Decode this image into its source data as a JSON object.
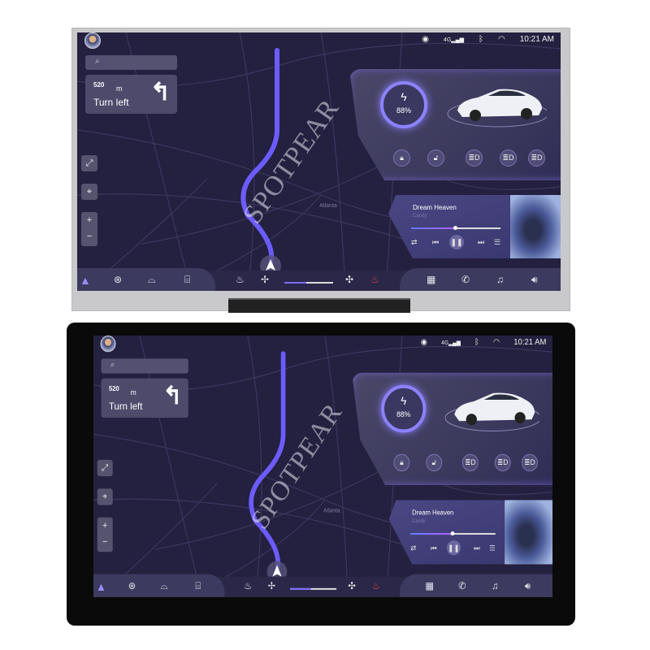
{
  "status": {
    "icons": [
      "eye-icon",
      "signal-4g-icon",
      "bluetooth-icon",
      "wifi-icon"
    ],
    "signal_label": "4G",
    "time": "10:21 AM"
  },
  "navigation": {
    "distance": "520",
    "unit": "m",
    "instruction": "Turn left",
    "map_label": "Atlanta"
  },
  "map_controls": {
    "zoom_in": "+",
    "zoom_out": "−"
  },
  "vehicle": {
    "battery_percent": "88%",
    "battery_level": 88,
    "controls": [
      "lock",
      "unlock",
      "headlight",
      "low-beam",
      "high-beam"
    ]
  },
  "music": {
    "title": "Dream Heaven",
    "artist": "Candy",
    "progress": 0.47
  },
  "climate": {
    "fan_level": 0.45
  },
  "bottom_bar": {
    "left": [
      "navigation",
      "steering-heat",
      "front-defrost",
      "rear-defrost"
    ],
    "right": [
      "apps",
      "phone",
      "music",
      "volume"
    ]
  },
  "watermark": "SPOTPEAR",
  "colors": {
    "background": "#24203f",
    "accent": "#8d82ff",
    "route": "#6b5cff"
  }
}
